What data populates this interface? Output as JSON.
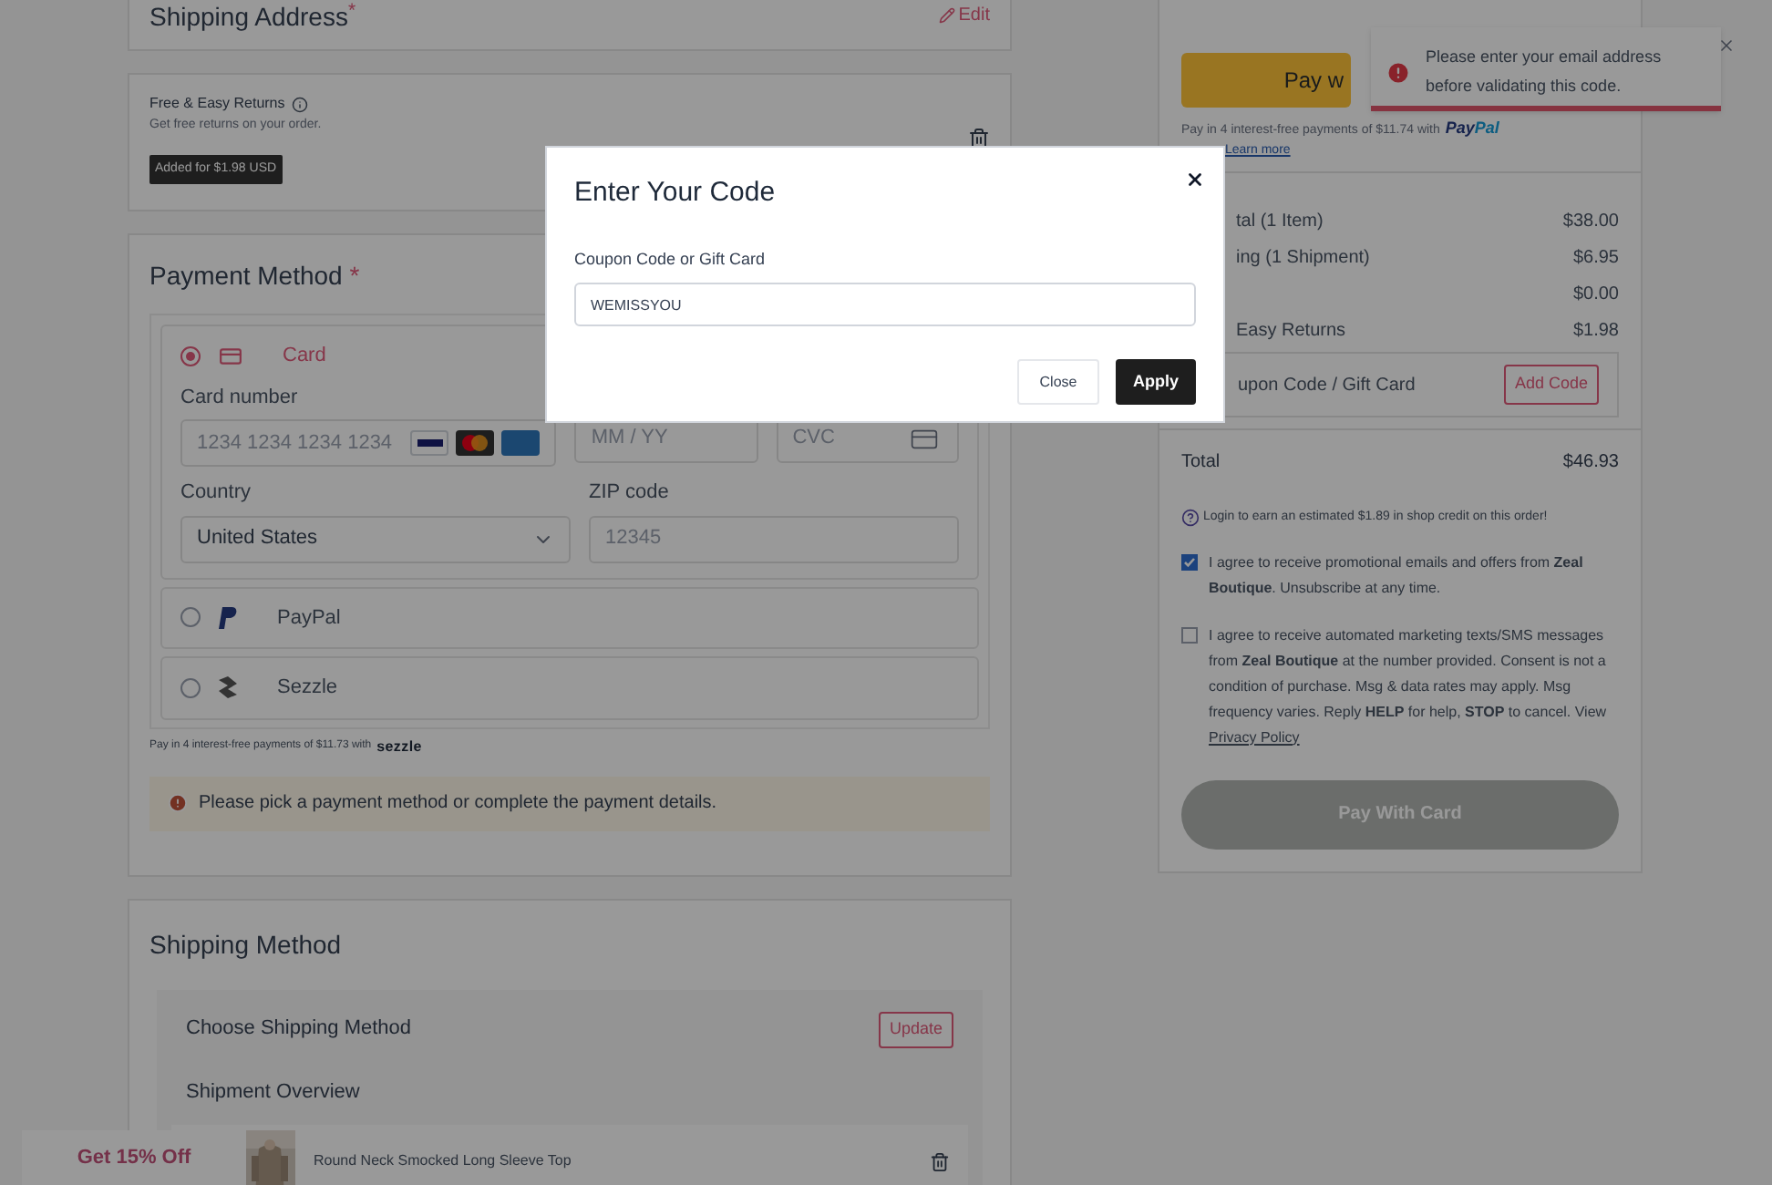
{
  "shipping_address": {
    "title": "Shipping Address",
    "required_mark": "*",
    "edit_link": "Edit"
  },
  "returns": {
    "title": "Free & Easy Returns",
    "subtitle": "Get free returns on your order.",
    "badge": "Added for $1.98 USD"
  },
  "payment": {
    "title": "Payment Method",
    "required_mark": "*",
    "options": [
      {
        "kind": "card",
        "label": "Card",
        "selected": true
      },
      {
        "kind": "paypal",
        "label": "PayPal",
        "selected": false
      },
      {
        "kind": "sezzle",
        "label": "Sezzle",
        "selected": false
      }
    ],
    "card_number_label": "Card number",
    "card_number_placeholder": "1234 1234 1234 1234",
    "expiry_placeholder": "MM / YY",
    "cvc_placeholder": "CVC",
    "country_label": "Country",
    "country_value": "United States",
    "zip_label": "ZIP code",
    "zip_placeholder": "12345",
    "installment_note": "Pay in 4 interest-free payments of $11.73 with",
    "installment_logo": "sezzle",
    "warning": "Please pick a payment method or complete the payment details."
  },
  "shipping_method": {
    "title": "Shipping Method",
    "choose_label": "Choose Shipping Method",
    "update_button": "Update",
    "overview_title": "Shipment Overview",
    "item_name": "Round Neck Smocked Long Sleeve Top"
  },
  "promo_tab": "Get 15% Off",
  "summary": {
    "paypal_button": "Pay w",
    "paypal_note": "Pay in 4 interest-free payments of $11.74 with",
    "paypal_logo_a": "Pay",
    "paypal_logo_b": "Pal",
    "learn_more": "Learn more",
    "rows": [
      {
        "label": "tal (1 Item)",
        "value": "$38.00"
      },
      {
        "label": "ing (1 Shipment)",
        "value": "$6.95"
      },
      {
        "label": "",
        "value": "$0.00"
      },
      {
        "label": "Easy Returns",
        "value": "$1.98"
      }
    ],
    "coupon_label": "upon Code / Gift Card",
    "add_code_button": "Add Code",
    "total_label": "Total",
    "total_value": "$46.93",
    "credit_note": "Login to earn an estimated $1.89 in shop credit on this order!",
    "consents": [
      {
        "text": "I agree to receive promotional emails and offers from **Zeal Boutique**. Unsubscribe at any time.",
        "checked": true
      },
      {
        "text": "I agree to receive automated marketing texts/SMS messages from **Zeal Boutique** at the number provided. Consent is not a condition of purchase. Msg & data rates may apply. Msg frequency varies. Reply **HELP** for help, **STOP** to cancel. View",
        "link": "Privacy Policy",
        "checked": false
      }
    ],
    "pay_button": "Pay With Card"
  },
  "toast": {
    "message": "Please enter your email address before validating this code."
  },
  "modal": {
    "title": "Enter Your Code",
    "field_label": "Coupon Code or Gift Card",
    "field_value": "WEMISSYOU",
    "close_button": "Close",
    "apply_button": "Apply"
  }
}
